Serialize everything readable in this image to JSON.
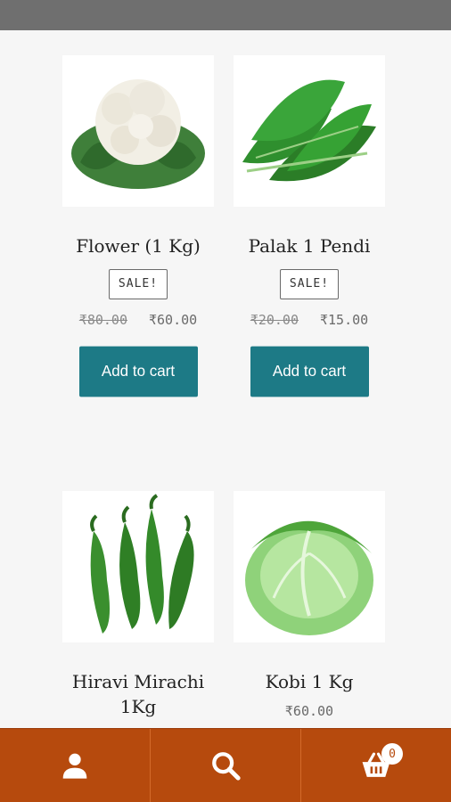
{
  "products": [
    {
      "title": "Flower (1 Kg)",
      "sale": "SALE!",
      "old_price": "₹80.00",
      "price": "₹60.00",
      "button": "Add to cart",
      "image": "cauliflower"
    },
    {
      "title": "Palak 1 Pendi",
      "sale": "SALE!",
      "old_price": "₹20.00",
      "price": "₹15.00",
      "button": "Add to cart",
      "image": "spinach"
    },
    {
      "title": "Hiravi Mirachi 1Kg",
      "image": "green-chillies"
    },
    {
      "title": "Kobi 1 Kg",
      "price": "₹60.00",
      "image": "cabbage"
    }
  ],
  "bottom_nav": {
    "items": [
      {
        "icon": "user-icon"
      },
      {
        "icon": "search-icon"
      },
      {
        "icon": "cart-icon",
        "badge": "0"
      }
    ]
  },
  "colors": {
    "status_bar": "#6f6f6f",
    "button": "#1d7a86",
    "bottom_nav": "#b64a0d",
    "background": "#f6f6f6"
  }
}
